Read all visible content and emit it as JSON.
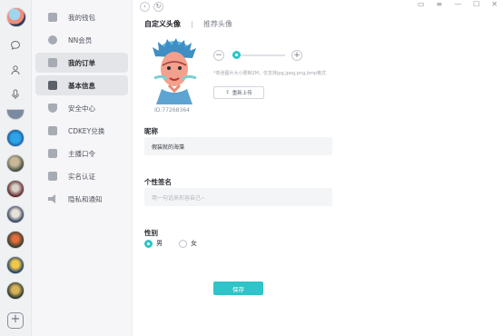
{
  "menu": {
    "items": [
      {
        "label": "我的钱包",
        "active": false
      },
      {
        "label": "NN会员",
        "active": false
      },
      {
        "label": "我的订单",
        "active": true
      },
      {
        "label": "基本信息",
        "active": true
      },
      {
        "label": "安全中心",
        "active": false
      },
      {
        "label": "CDKEY兑换",
        "active": false
      },
      {
        "label": "主播口令",
        "active": false
      },
      {
        "label": "实名认证",
        "active": false
      },
      {
        "label": "隐私和通知",
        "active": false
      }
    ]
  },
  "tabs": {
    "active": "自定义头像",
    "inactive": "推荐头像"
  },
  "avatar_editor": {
    "uid": "ID:77268364",
    "zoom_level": 0.0,
    "hint": "*单张图片大小限制2M，仅支持jpg,jpeg,png,bmp格式",
    "upload_label": "重新上传"
  },
  "form": {
    "nickname_label": "昵称",
    "nickname_value": "假装就的海藻",
    "signature_label": "个性签名",
    "signature_placeholder": "用一句话来形容自己~",
    "gender_label": "性别",
    "gender_options": [
      "男",
      "女"
    ],
    "gender_selected": "男",
    "save_label": "保存"
  },
  "colors": {
    "accent": "#2ec4c9"
  }
}
